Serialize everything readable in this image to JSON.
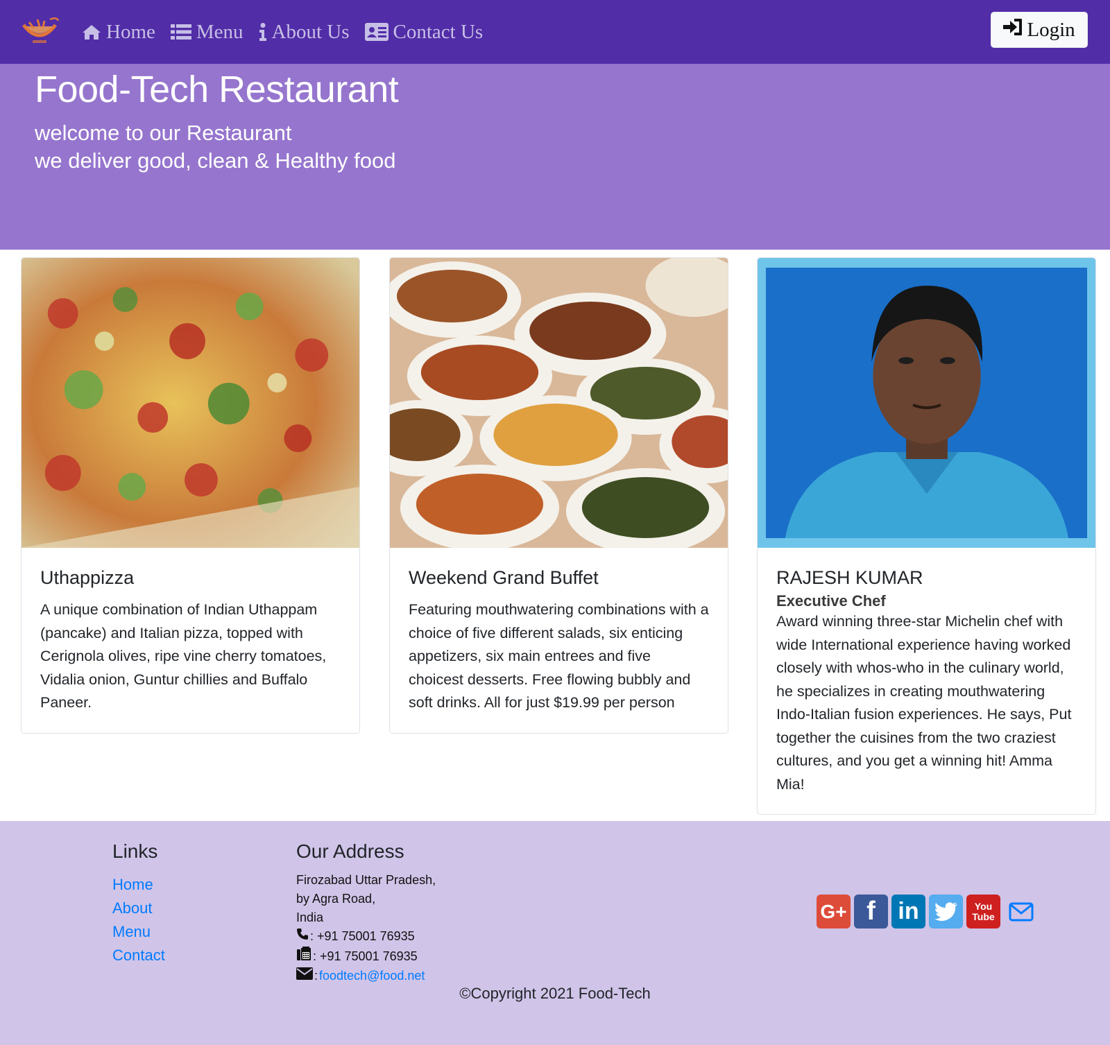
{
  "nav": {
    "brand_icon": "restaurant-logo",
    "items": [
      {
        "label": "Home",
        "icon": "home-icon"
      },
      {
        "label": "Menu",
        "icon": "list-icon"
      },
      {
        "label": "About Us",
        "icon": "info-icon"
      },
      {
        "label": "Contact Us",
        "icon": "address-card-icon"
      }
    ],
    "login_label": "Login",
    "bg_color": "#512da8"
  },
  "jumbotron": {
    "title": "Food-Tech Restaurant",
    "subtitle_line1": "welcome to our Restaurant",
    "subtitle_line2": "we deliver good, clean & Healthy food",
    "bg_color": "#9575cd"
  },
  "cards": [
    {
      "title": "Uthappizza",
      "text": "A unique combination of Indian Uthappam (pancake) and Italian pizza, topped with Cerignola olives, ripe vine cherry tomatoes, Vidalia onion, Guntur chillies and Buffalo Paneer.",
      "image": "uthappizza-photo"
    },
    {
      "title": "Weekend Grand Buffet",
      "text": "Featuring mouthwatering combinations with a choice of five different salads, six enticing appetizers, six main entrees and five choicest desserts. Free flowing bubbly and soft drinks. All for just $19.99 per person",
      "image": "buffet-photo"
    },
    {
      "title": "RAJESH KUMAR",
      "subtitle": "Executive Chef",
      "text": "Award winning three-star Michelin chef with wide International experience having worked closely with whos-who in the culinary world, he specializes in creating mouthwatering Indo-Italian fusion experiences. He says, Put together the cuisines from the two craziest cultures, and you get a winning hit! Amma Mia!",
      "image": "chef-portrait-photo"
    }
  ],
  "footer": {
    "links_heading": "Links",
    "links": [
      "Home",
      "About",
      "Menu",
      "Contact"
    ],
    "address_heading": "Our Address",
    "address_line1": "Firozabad Uttar Pradesh,",
    "address_line2": "by Agra Road,",
    "address_line3": "India",
    "phone": ": +91 75001 76935",
    "fax": ": +91 75001 76935",
    "email_prefix": ": ",
    "email": "foodtech@food.net",
    "social": [
      {
        "label": "G+",
        "icon": "google-plus-icon",
        "color": "#dd4b39"
      },
      {
        "label": "f",
        "icon": "facebook-icon",
        "color": "#3b5998"
      },
      {
        "label": "in",
        "icon": "linkedin-icon",
        "color": "#0077b5"
      },
      {
        "label": "",
        "icon": "twitter-icon",
        "color": "#55acee"
      },
      {
        "label": "You Tube",
        "icon": "youtube-icon",
        "color": "#cd201f"
      },
      {
        "label": "",
        "icon": "mail-icon",
        "color": "#007bff"
      }
    ],
    "copyright": "©Copyright 2021 Food-Tech",
    "bg_color": "#d1c4e9"
  }
}
